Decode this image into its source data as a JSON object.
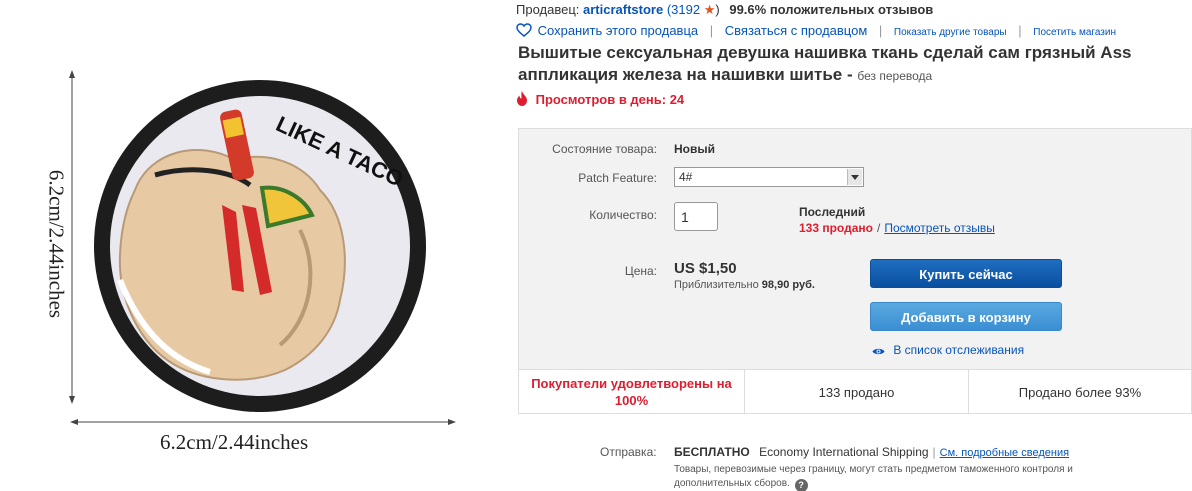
{
  "image": {
    "dim_bottom": "6.2cm/2.44inches",
    "dim_left": "6.2cm/2.44inches",
    "patch_text": "LIKE A TACO"
  },
  "seller": {
    "label": "Продавец:",
    "name": "articraftstore",
    "score_open": "(3192",
    "score_close": ")",
    "positive": "99.6% положительных отзывов"
  },
  "seller_actions": {
    "save": "Сохранить этого продавца",
    "contact": "Связаться с продавцом",
    "other_items": "Показать другие товары",
    "visit_store": "Посетить магазин"
  },
  "listing": {
    "title": "Вышитые сексуальная девушка нашивка ткань сделай сам грязный Ass аппликация железа на нашивки шитье -",
    "title_note": "без перевода",
    "views": "Просмотров в день: 24"
  },
  "details": {
    "condition_label": "Состояние товара:",
    "condition_value": "Новый",
    "patch_label": "Patch Feature:",
    "patch_value": "4#",
    "quantity_label": "Количество:",
    "quantity_value": "1",
    "last_label": "Последний",
    "sold_count": "133 продано",
    "slash": "/",
    "reviews_link": "Посмотреть отзывы",
    "price_label": "Цена:",
    "price_value": "US $1,50",
    "approx_label": "Приблизительно",
    "approx_value": "98,90 руб."
  },
  "buttons": {
    "buy_now": "Купить сейчас",
    "add_to_cart": "Добавить в корзину",
    "watch": "В список отслеживания"
  },
  "stats": {
    "satisfied": "Покупатели удовлетворены на 100%",
    "sold": "133 продано",
    "sold_percent": "Продано более 93%"
  },
  "shipping": {
    "label": "Отправка:",
    "free": "БЕСПЛАТНО",
    "service": "Economy International Shipping",
    "details_link": "См. подробные сведения",
    "note": "Товары, перевозимые через границу, могут стать предметом таможенного контроля и дополнительных сборов."
  },
  "colors": {
    "link": "#0654ba",
    "alert": "#dd1e31",
    "buy_button": "#0a4fa0",
    "cart_button": "#3a8ed2",
    "star": "#e5531a"
  }
}
